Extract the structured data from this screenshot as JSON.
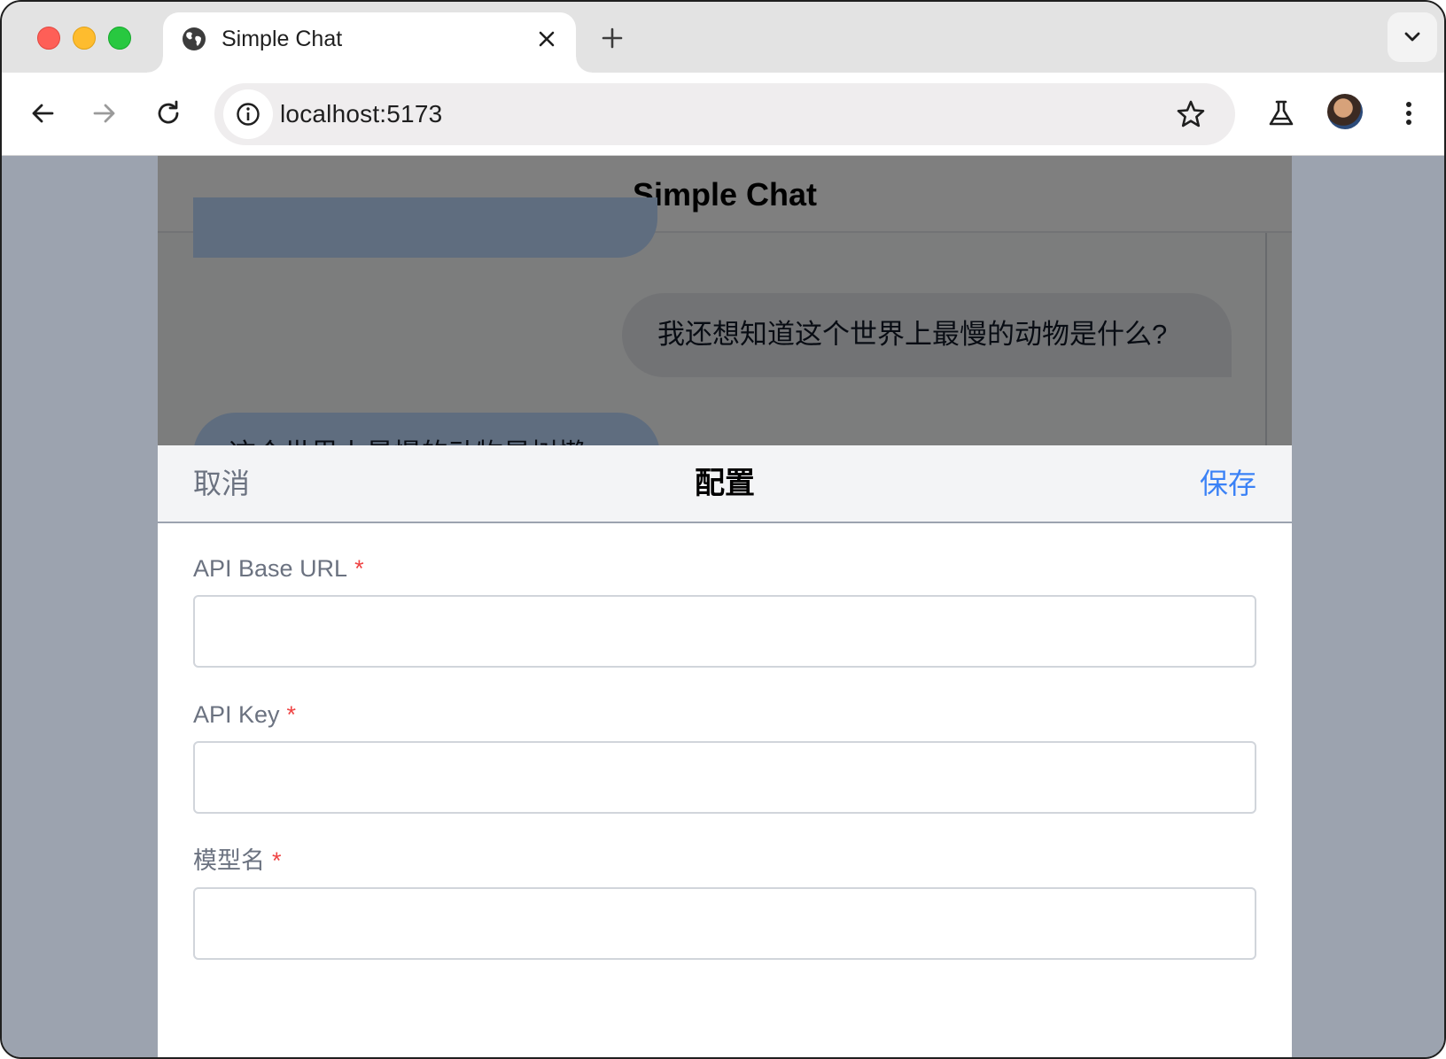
{
  "browser": {
    "tab_title": "Simple Chat",
    "url": "localhost:5173"
  },
  "app": {
    "title": "Simple Chat",
    "messages": {
      "user_question": "我还想知道这个世界上最慢的动物是什么?",
      "ai_partial": "这个世界上最慢的动物是树懒"
    }
  },
  "config": {
    "cancel_label": "取消",
    "title": "配置",
    "save_label": "保存",
    "required_marker": "*",
    "fields": [
      {
        "label": "API Base URL",
        "value": ""
      },
      {
        "label": "API Key",
        "value": ""
      },
      {
        "label": "模型名",
        "value": ""
      }
    ]
  },
  "colors": {
    "accent": "#3b82f6",
    "required": "#ef4444",
    "ai_bubble": "#bfdbfe",
    "user_bubble": "#e5e7eb"
  }
}
